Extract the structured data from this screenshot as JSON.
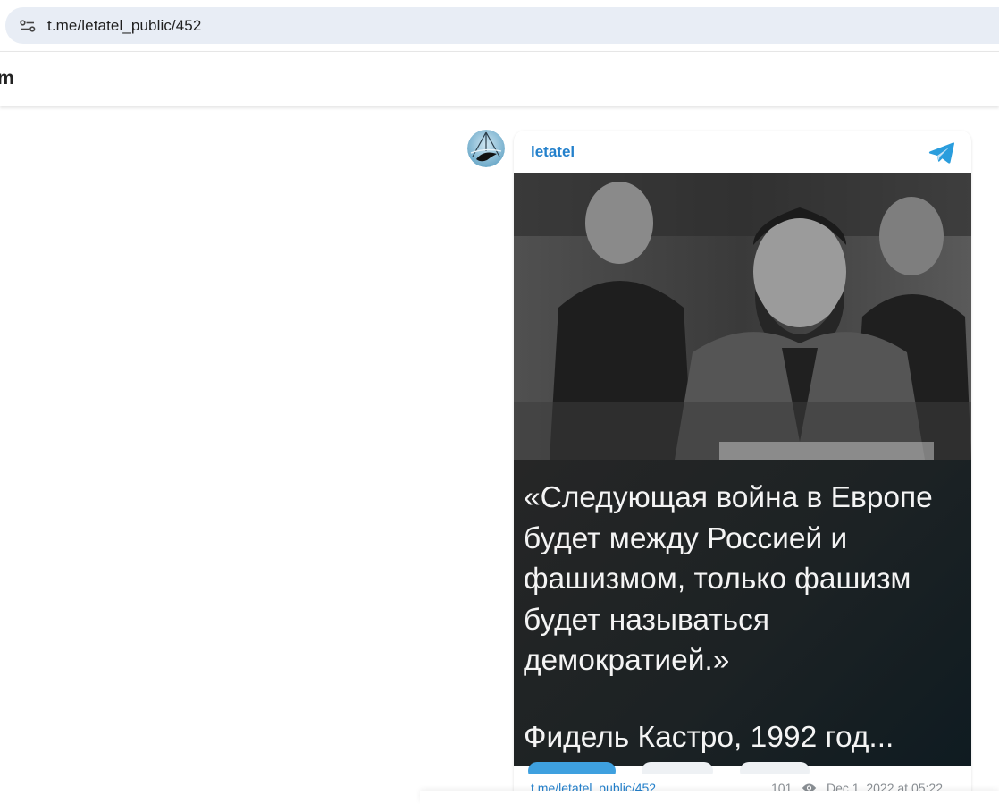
{
  "browser": {
    "url": "t.me/letatel_public/452"
  },
  "header": {
    "brand_fragment": "m"
  },
  "post": {
    "channel_name": "letatel",
    "quote": "«Следующая война в Европе\nбудет между Россией и\nфашизмом, только фашизм\nбудет называться\nдемократией.»",
    "author": "Фидель Кастро, 1992 год...",
    "link": "t.me/letatel_public/452",
    "views": "101",
    "date": "Dec 1, 2022 at 05:22"
  },
  "icons": {
    "site_info": "site-info-icon",
    "telegram": "telegram-logo-icon",
    "views": "eye-icon",
    "avatar": "channel-avatar"
  },
  "colors": {
    "accent": "#2481cc",
    "muted": "#8a8f94",
    "url_bar": "#e8edf5"
  }
}
